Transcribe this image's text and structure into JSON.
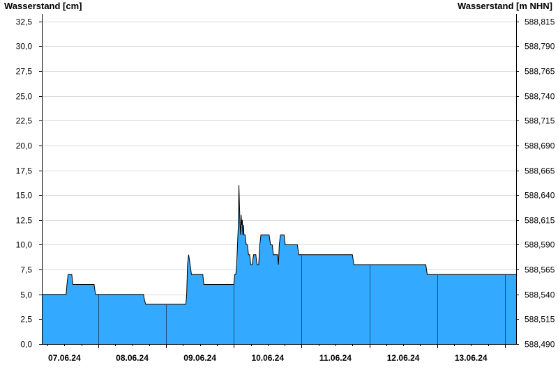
{
  "chart_data": {
    "type": "area",
    "title": "",
    "ylabel_left": "Wasserstand [cm]",
    "ylabel_right": "Wasserstand [m NHN]",
    "ylim": [
      0,
      33.25
    ],
    "y_ticks_left": [
      "0,0",
      "2,5",
      "5,0",
      "7,5",
      "10,0",
      "12,5",
      "15,0",
      "17,5",
      "20,0",
      "22,5",
      "25,0",
      "27,5",
      "30,0",
      "32,5"
    ],
    "y_ticks_right": [
      "588,490",
      "588,515",
      "588,540",
      "588,565",
      "588,590",
      "588,615",
      "588,640",
      "588,665",
      "588,690",
      "588,715",
      "588,740",
      "588,765",
      "588,790",
      "588,815"
    ],
    "x_labels": [
      "07.06.24",
      "08.06.24",
      "09.06.24",
      "10.06.24",
      "11.06.24",
      "12.06.24",
      "13.06.24"
    ],
    "x_unit": "hours since 07.06.24 00:00",
    "xlim": [
      -8,
      160
    ],
    "grid": true,
    "fill_color": "#33AAFF",
    "series": [
      {
        "name": "",
        "points": [
          [
            -8,
            5
          ],
          [
            0.6,
            5
          ],
          [
            0.9,
            6
          ],
          [
            1.3,
            7
          ],
          [
            2.6,
            7
          ],
          [
            3,
            6
          ],
          [
            10.5,
            6
          ],
          [
            11,
            5
          ],
          [
            28,
            5
          ],
          [
            28.3,
            4.5
          ],
          [
            28.8,
            4
          ],
          [
            43,
            4
          ],
          [
            43.3,
            5
          ],
          [
            43.6,
            8
          ],
          [
            44,
            9
          ],
          [
            44.5,
            8
          ],
          [
            45,
            7
          ],
          [
            49,
            7
          ],
          [
            49.4,
            6
          ],
          [
            60,
            6
          ],
          [
            60.3,
            7
          ],
          [
            60.7,
            7
          ],
          [
            61,
            8
          ],
          [
            61.3,
            10
          ],
          [
            61.6,
            12
          ],
          [
            61.8,
            16
          ],
          [
            62,
            14
          ],
          [
            62.2,
            12
          ],
          [
            62.4,
            11
          ],
          [
            62.6,
            13
          ],
          [
            62.8,
            12
          ],
          [
            63,
            12.5
          ],
          [
            63.2,
            11
          ],
          [
            63.4,
            12
          ],
          [
            63.6,
            11
          ],
          [
            64,
            11
          ],
          [
            64.4,
            10
          ],
          [
            64.8,
            10
          ],
          [
            65.2,
            9
          ],
          [
            65.6,
            9
          ],
          [
            66,
            8
          ],
          [
            66.5,
            8
          ],
          [
            67,
            9
          ],
          [
            67.8,
            9
          ],
          [
            68.2,
            8
          ],
          [
            68.8,
            8
          ],
          [
            69.2,
            10
          ],
          [
            69.6,
            11
          ],
          [
            72.5,
            11
          ],
          [
            73,
            10
          ],
          [
            73.6,
            10
          ],
          [
            74,
            9
          ],
          [
            75.5,
            9
          ],
          [
            75.8,
            8
          ],
          [
            76.1,
            10
          ],
          [
            76.5,
            11
          ],
          [
            77.8,
            11
          ],
          [
            78.2,
            10
          ],
          [
            82.5,
            10
          ],
          [
            83,
            9
          ],
          [
            102,
            9
          ],
          [
            102.5,
            8
          ],
          [
            128,
            8
          ],
          [
            128.5,
            7
          ],
          [
            160,
            7
          ]
        ]
      }
    ]
  }
}
